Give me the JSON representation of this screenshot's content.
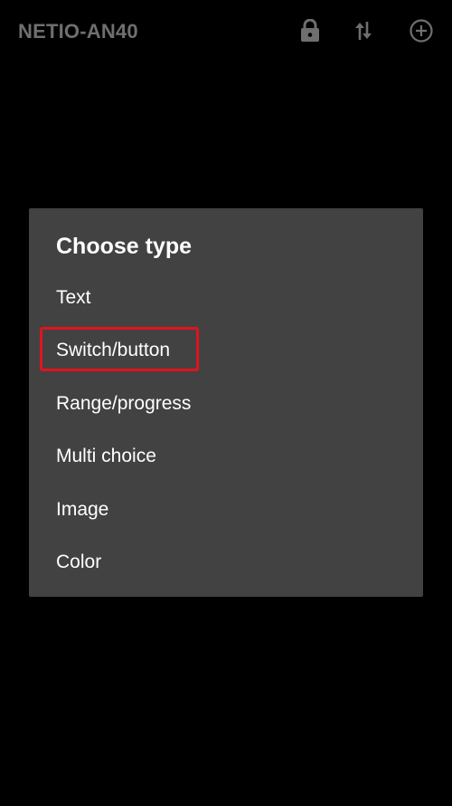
{
  "toolbar": {
    "title": "NETIO-AN40",
    "icons": [
      "lock-icon",
      "sort-arrows-icon",
      "add-circle-icon"
    ],
    "icon_color": "#6f6f6f"
  },
  "dialog": {
    "title": "Choose type",
    "options": [
      {
        "label": "Text"
      },
      {
        "label": "Switch/button",
        "highlighted": true
      },
      {
        "label": "Range/progress"
      },
      {
        "label": "Multi choice"
      },
      {
        "label": "Image"
      },
      {
        "label": "Color"
      }
    ]
  },
  "colors": {
    "background": "#000000",
    "dialog_background": "#424242",
    "text": "#ffffff",
    "highlight_border": "#e0141c"
  }
}
